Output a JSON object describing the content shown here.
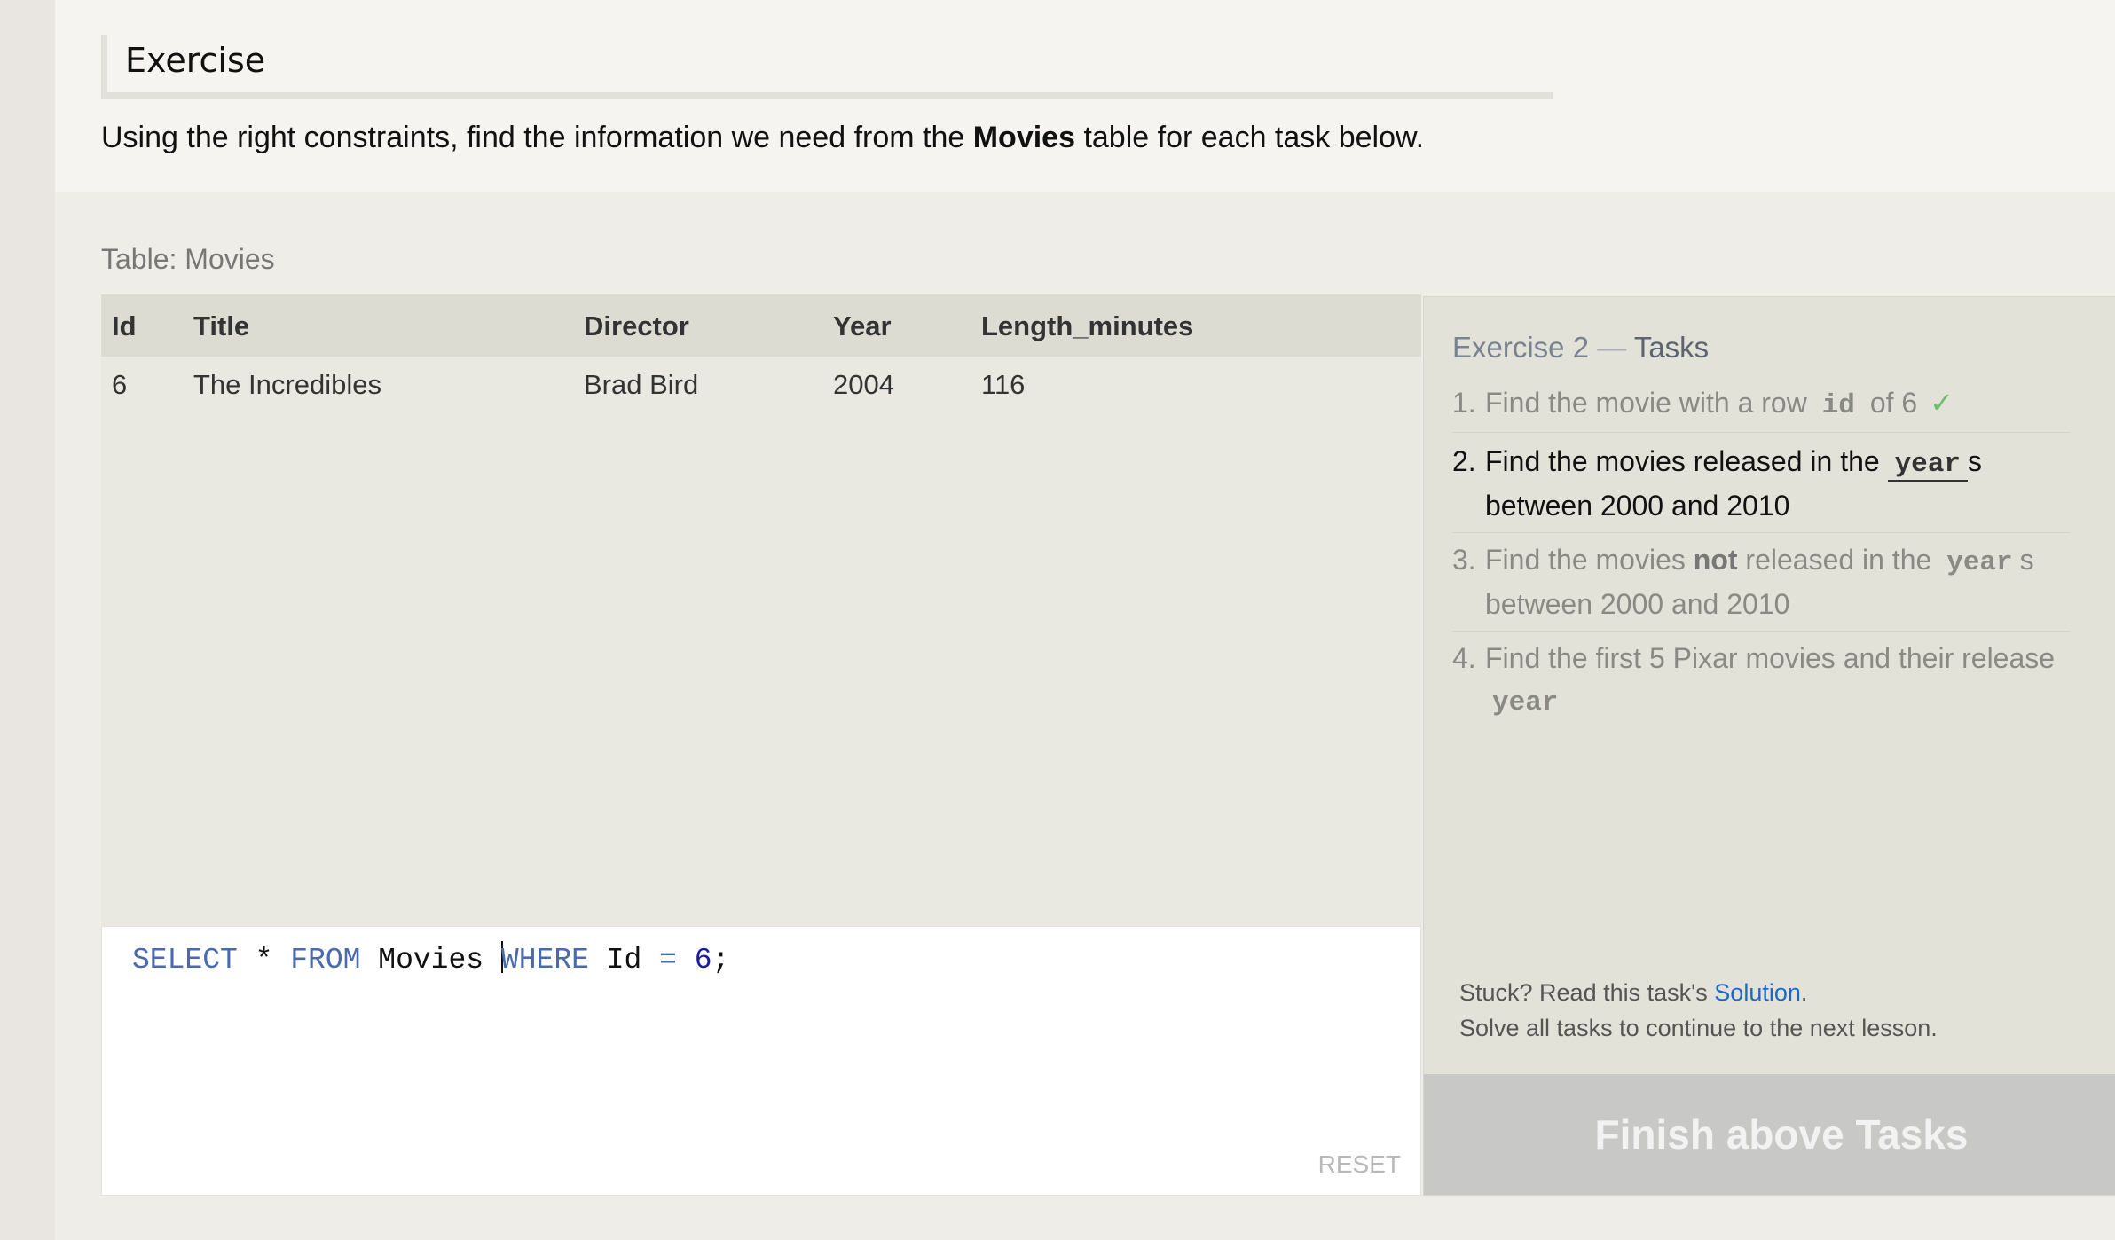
{
  "intro": {
    "heading": "Exercise",
    "text_before": "Using the right constraints, find the information we need from the ",
    "text_bold": "Movies",
    "text_after": " table for each task below."
  },
  "table": {
    "caption": "Table: Movies",
    "columns": [
      "Id",
      "Title",
      "Director",
      "Year",
      "Length_minutes"
    ],
    "rows": [
      [
        "6",
        "The Incredibles",
        "Brad Bird",
        "2004",
        "116"
      ]
    ]
  },
  "editor": {
    "tokens": {
      "select": "SELECT",
      "star": " * ",
      "from": "FROM",
      "movies": " Movies ",
      "where": "WHERE",
      "id": " Id ",
      "eq": "=",
      "space": " ",
      "six": "6",
      "semi": ";"
    },
    "reset_label": "RESET"
  },
  "tasks": {
    "title_prefix": "Exercise 2",
    "title_dash": " — ",
    "title_suffix": "Tasks",
    "items": [
      {
        "num": "1.",
        "a": "Find the movie with a row ",
        "code": "id",
        "b": " of 6",
        "check": "✓",
        "status": "done"
      },
      {
        "num": "2.",
        "a": "Find the movies released in the ",
        "code": "year",
        "b": "s between 2000 and 2010",
        "status": "active"
      },
      {
        "num": "3.",
        "a": "Find the movies ",
        "bold": "not",
        "a2": " released in the ",
        "code": "year",
        "b": "s between 2000 and 2010",
        "status": "pending"
      },
      {
        "num": "4.",
        "a": "Find the first 5 Pixar movies and their release ",
        "code": "year",
        "status": "pending"
      }
    ],
    "stuck_text": "Stuck? Read this task's ",
    "solution_link": "Solution",
    "stuck_period": ".",
    "continue_text": "Solve all tasks to continue to the next lesson.",
    "finish_label": "Finish above Tasks"
  }
}
